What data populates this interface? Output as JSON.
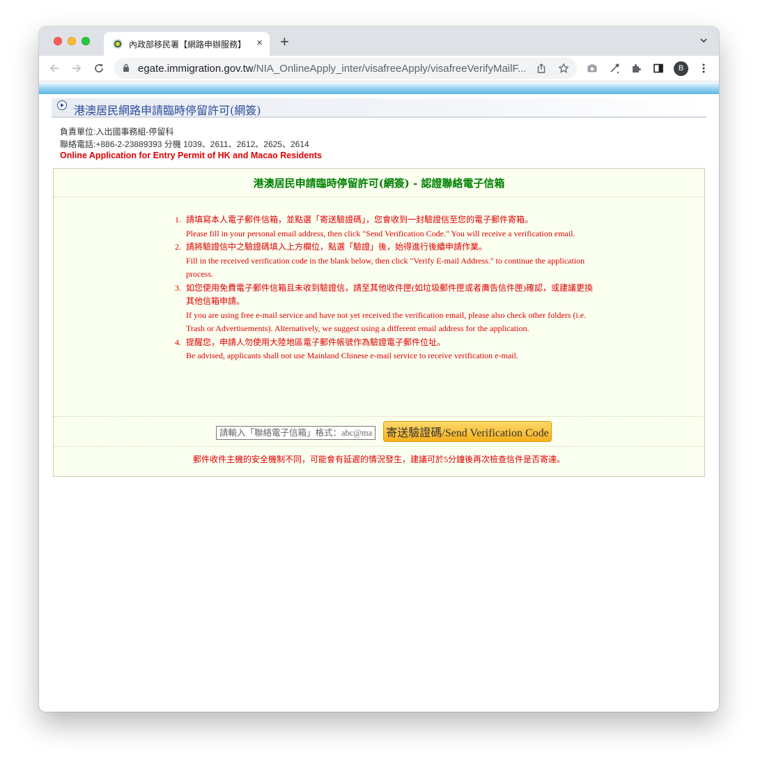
{
  "browser": {
    "tab_title": "內政部移民署【網路申辦服務】",
    "tab_close": "×",
    "new_tab": "+",
    "url_host": "egate.immigration.gov.tw",
    "url_path": "/NIA_OnlineApply_inter/visafreeApply/visafreeVerifyMailF...",
    "profile_initial": "B"
  },
  "page": {
    "title": "港澳居民網路申請臨時停留許可(網簽)",
    "department": "負責單位:入出國事務組-停留科",
    "phone": "聯絡電話:+886-2-23889393 分機 1039、2611、2612、2625、2614",
    "english_title": "Online Application for Entry Permit of HK and Macao Residents"
  },
  "panel": {
    "title": "港澳居民申請臨時停留許可(網簽) - 認證聯絡電子信箱",
    "instructions": [
      {
        "num": "1.",
        "zh": "請填寫本人電子郵件信箱，並點選「寄送驗證碼」，您會收到一封驗證信至您的電子郵件寄箱。",
        "en": "Please fill in your personal email address, then click \"Send Verification Code.\" You will receive a verification email."
      },
      {
        "num": "2.",
        "zh": "請將驗證信中之驗證碼填入上方欄位，點選「驗證」後，始得進行後續申請作業。",
        "en": "Fill in the received verification code in the blank below, then click \"Verify E-mail Address.\" to continue the application process."
      },
      {
        "num": "3.",
        "zh": "如您使用免費電子郵件信箱且未收到驗證信，請至其他收件匣(如垃圾郵件匣或者廣告信件匣)確認，或建議更換其他信箱申請。",
        "en": "If you are using free e-mail service and have not yet received the verification email, please also check other folders (i.e. Trash or Advertisements). Alternatively, we suggest using a different email address for the application."
      },
      {
        "num": "4.",
        "zh": "提醒您，申請人勿使用大陸地區電子郵件帳號作為驗證電子郵件位址。",
        "en": "Be advised, applicants shall not use Mainland Chinese e-mail service to receive verification e-mail."
      }
    ],
    "email_placeholder": "請輸入「聯絡電子信箱」格式：abc@mail.com",
    "email_value": "",
    "send_button": "寄送驗證碼/Send Verification Code",
    "notice": "郵件收件主機的安全機制不同，可能會有延遲的情況發生，建議可於5分鐘後再次檢查信件是否寄達。"
  }
}
